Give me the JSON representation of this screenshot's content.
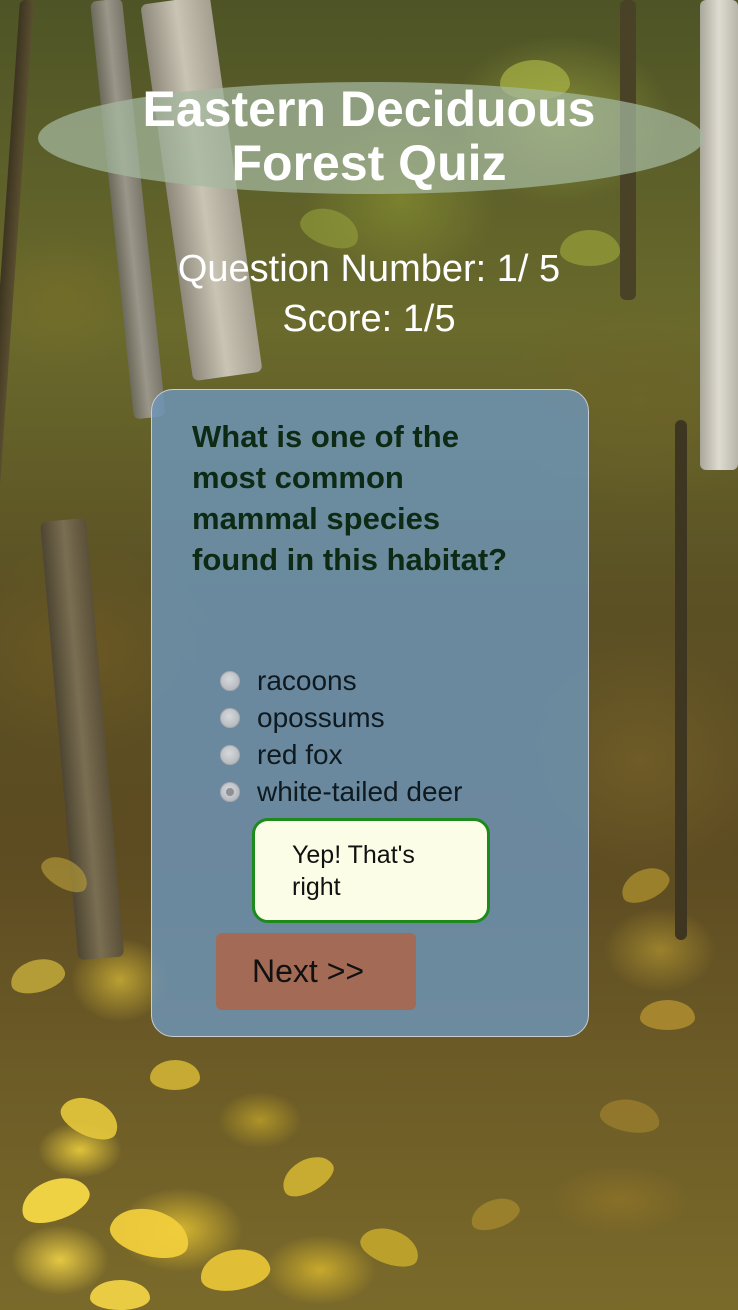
{
  "title": {
    "line1": "Eastern Deciduous",
    "line2": "Forest Quiz"
  },
  "status": {
    "question_number": "Question Number: 1/ 5",
    "score": "Score: 1/5"
  },
  "quiz": {
    "question": "What is one of the most common mammal species found in this habitat?",
    "options": [
      {
        "label": "racoons",
        "selected": false
      },
      {
        "label": "opossums",
        "selected": false
      },
      {
        "label": "red fox",
        "selected": false
      },
      {
        "label": "white-tailed deer",
        "selected": true
      }
    ],
    "feedback": "Yep! That's right",
    "next_label": "Next >>"
  },
  "colors": {
    "card": "#6e96b9",
    "question_text": "#0d2a14",
    "feedback_border": "#1e8a1e",
    "feedback_bg": "#fbfde6",
    "next_button": "#a36b55"
  }
}
